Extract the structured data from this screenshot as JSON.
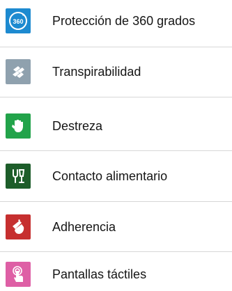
{
  "features": [
    {
      "icon": "360-protection-icon",
      "label": "Protección de 360 grados",
      "color": "#1d8ad0"
    },
    {
      "icon": "breathability-icon",
      "label": "Transpirabilidad",
      "color": "#8fa1ae"
    },
    {
      "icon": "dexterity-hand-icon",
      "label": "Destreza",
      "color": "#22a34a"
    },
    {
      "icon": "food-contact-icon",
      "label": "Contacto alimentario",
      "color": "#1d5d2a"
    },
    {
      "icon": "grip-hand-icon",
      "label": "Adherencia",
      "color": "#c62f2f"
    },
    {
      "icon": "touchscreen-icon",
      "label": "Pantallas táctiles",
      "color": "#de5fa5"
    }
  ]
}
